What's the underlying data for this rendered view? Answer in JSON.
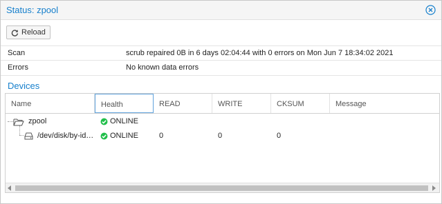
{
  "window": {
    "title": "Status: zpool",
    "close_icon": "close-circle-icon"
  },
  "toolbar": {
    "reload_label": "Reload",
    "reload_icon": "refresh-icon"
  },
  "info": {
    "scan_label": "Scan",
    "scan_value": "scrub repaired 0B in 6 days 02:04:44 with 0 errors on Mon Jun 7 18:34:02 2021",
    "errors_label": "Errors",
    "errors_value": "No known data errors"
  },
  "devices": {
    "title": "Devices",
    "columns": [
      "Name",
      "Health",
      "READ",
      "WRITE",
      "CKSUM",
      "Message"
    ],
    "rows": [
      {
        "name": "zpool",
        "icon": "folder-open-icon",
        "health": "ONLINE",
        "read": "",
        "write": "",
        "cksum": "",
        "message": ""
      },
      {
        "name": "/dev/disk/by-id…",
        "icon": "disk-drive-icon",
        "health": "ONLINE",
        "read": "0",
        "write": "0",
        "cksum": "0",
        "message": ""
      }
    ]
  },
  "colors": {
    "accent": "#157fcc",
    "online": "#21bf4b",
    "active_column_border": "#5fa2dd"
  }
}
